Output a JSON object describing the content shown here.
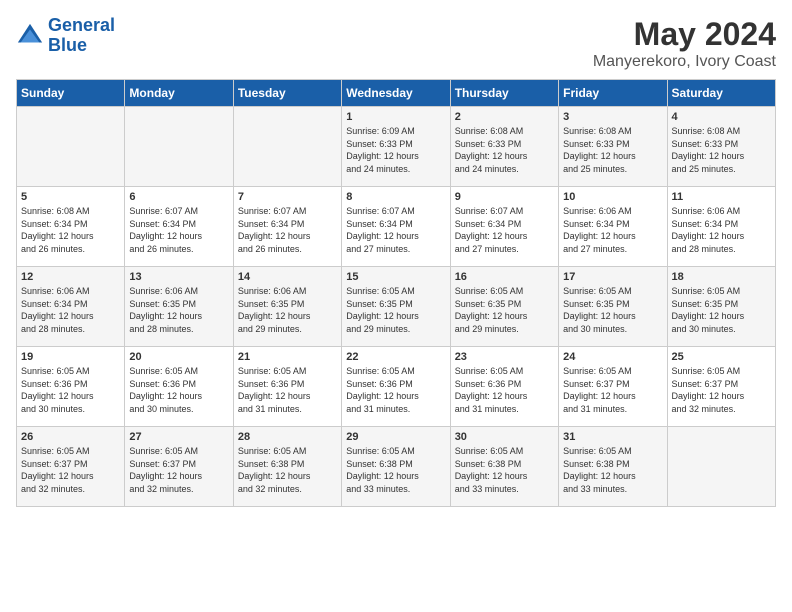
{
  "header": {
    "logo_line1": "General",
    "logo_line2": "Blue",
    "main_title": "May 2024",
    "subtitle": "Manyerekoro, Ivory Coast"
  },
  "days_of_week": [
    "Sunday",
    "Monday",
    "Tuesday",
    "Wednesday",
    "Thursday",
    "Friday",
    "Saturday"
  ],
  "weeks": [
    [
      {
        "day": "",
        "info": ""
      },
      {
        "day": "",
        "info": ""
      },
      {
        "day": "",
        "info": ""
      },
      {
        "day": "1",
        "info": "Sunrise: 6:09 AM\nSunset: 6:33 PM\nDaylight: 12 hours\nand 24 minutes."
      },
      {
        "day": "2",
        "info": "Sunrise: 6:08 AM\nSunset: 6:33 PM\nDaylight: 12 hours\nand 24 minutes."
      },
      {
        "day": "3",
        "info": "Sunrise: 6:08 AM\nSunset: 6:33 PM\nDaylight: 12 hours\nand 25 minutes."
      },
      {
        "day": "4",
        "info": "Sunrise: 6:08 AM\nSunset: 6:33 PM\nDaylight: 12 hours\nand 25 minutes."
      }
    ],
    [
      {
        "day": "5",
        "info": "Sunrise: 6:08 AM\nSunset: 6:34 PM\nDaylight: 12 hours\nand 26 minutes."
      },
      {
        "day": "6",
        "info": "Sunrise: 6:07 AM\nSunset: 6:34 PM\nDaylight: 12 hours\nand 26 minutes."
      },
      {
        "day": "7",
        "info": "Sunrise: 6:07 AM\nSunset: 6:34 PM\nDaylight: 12 hours\nand 26 minutes."
      },
      {
        "day": "8",
        "info": "Sunrise: 6:07 AM\nSunset: 6:34 PM\nDaylight: 12 hours\nand 27 minutes."
      },
      {
        "day": "9",
        "info": "Sunrise: 6:07 AM\nSunset: 6:34 PM\nDaylight: 12 hours\nand 27 minutes."
      },
      {
        "day": "10",
        "info": "Sunrise: 6:06 AM\nSunset: 6:34 PM\nDaylight: 12 hours\nand 27 minutes."
      },
      {
        "day": "11",
        "info": "Sunrise: 6:06 AM\nSunset: 6:34 PM\nDaylight: 12 hours\nand 28 minutes."
      }
    ],
    [
      {
        "day": "12",
        "info": "Sunrise: 6:06 AM\nSunset: 6:34 PM\nDaylight: 12 hours\nand 28 minutes."
      },
      {
        "day": "13",
        "info": "Sunrise: 6:06 AM\nSunset: 6:35 PM\nDaylight: 12 hours\nand 28 minutes."
      },
      {
        "day": "14",
        "info": "Sunrise: 6:06 AM\nSunset: 6:35 PM\nDaylight: 12 hours\nand 29 minutes."
      },
      {
        "day": "15",
        "info": "Sunrise: 6:05 AM\nSunset: 6:35 PM\nDaylight: 12 hours\nand 29 minutes."
      },
      {
        "day": "16",
        "info": "Sunrise: 6:05 AM\nSunset: 6:35 PM\nDaylight: 12 hours\nand 29 minutes."
      },
      {
        "day": "17",
        "info": "Sunrise: 6:05 AM\nSunset: 6:35 PM\nDaylight: 12 hours\nand 30 minutes."
      },
      {
        "day": "18",
        "info": "Sunrise: 6:05 AM\nSunset: 6:35 PM\nDaylight: 12 hours\nand 30 minutes."
      }
    ],
    [
      {
        "day": "19",
        "info": "Sunrise: 6:05 AM\nSunset: 6:36 PM\nDaylight: 12 hours\nand 30 minutes."
      },
      {
        "day": "20",
        "info": "Sunrise: 6:05 AM\nSunset: 6:36 PM\nDaylight: 12 hours\nand 30 minutes."
      },
      {
        "day": "21",
        "info": "Sunrise: 6:05 AM\nSunset: 6:36 PM\nDaylight: 12 hours\nand 31 minutes."
      },
      {
        "day": "22",
        "info": "Sunrise: 6:05 AM\nSunset: 6:36 PM\nDaylight: 12 hours\nand 31 minutes."
      },
      {
        "day": "23",
        "info": "Sunrise: 6:05 AM\nSunset: 6:36 PM\nDaylight: 12 hours\nand 31 minutes."
      },
      {
        "day": "24",
        "info": "Sunrise: 6:05 AM\nSunset: 6:37 PM\nDaylight: 12 hours\nand 31 minutes."
      },
      {
        "day": "25",
        "info": "Sunrise: 6:05 AM\nSunset: 6:37 PM\nDaylight: 12 hours\nand 32 minutes."
      }
    ],
    [
      {
        "day": "26",
        "info": "Sunrise: 6:05 AM\nSunset: 6:37 PM\nDaylight: 12 hours\nand 32 minutes."
      },
      {
        "day": "27",
        "info": "Sunrise: 6:05 AM\nSunset: 6:37 PM\nDaylight: 12 hours\nand 32 minutes."
      },
      {
        "day": "28",
        "info": "Sunrise: 6:05 AM\nSunset: 6:38 PM\nDaylight: 12 hours\nand 32 minutes."
      },
      {
        "day": "29",
        "info": "Sunrise: 6:05 AM\nSunset: 6:38 PM\nDaylight: 12 hours\nand 33 minutes."
      },
      {
        "day": "30",
        "info": "Sunrise: 6:05 AM\nSunset: 6:38 PM\nDaylight: 12 hours\nand 33 minutes."
      },
      {
        "day": "31",
        "info": "Sunrise: 6:05 AM\nSunset: 6:38 PM\nDaylight: 12 hours\nand 33 minutes."
      },
      {
        "day": "",
        "info": ""
      }
    ]
  ]
}
